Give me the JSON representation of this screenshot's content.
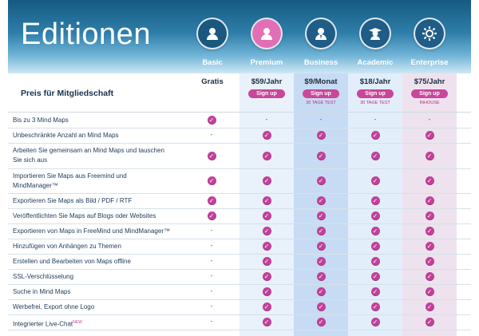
{
  "title": "Editionen",
  "columns": [
    {
      "name": "Basic",
      "price": "Gratis",
      "signup": "",
      "note": ""
    },
    {
      "name": "Premium",
      "price": "$59/Jahr",
      "signup": "Sign up",
      "note": ""
    },
    {
      "name": "Business",
      "price": "$9/Monat",
      "signup": "Sign up",
      "note": "30 TAGE TEST"
    },
    {
      "name": "Academic",
      "price": "$18/Jahr",
      "signup": "Sign up",
      "note": "30 TAGE TEST"
    },
    {
      "name": "Enterprise",
      "price": "$75/Jahr",
      "signup": "Sign up",
      "note": "INHOUSE"
    }
  ],
  "price_label": "Preis für Mitgliedschaft",
  "features": [
    {
      "label": "Bis zu 3 Mind Maps",
      "values": [
        "check",
        "dash",
        "dash",
        "dash",
        "dash"
      ]
    },
    {
      "label": "Unbeschränkte Anzahl an Mind Maps",
      "values": [
        "dash",
        "check",
        "check",
        "check",
        "check"
      ]
    },
    {
      "label": "Arbeiten Sie gemeinsam an Mind Maps und tauschen Sie sich aus",
      "values": [
        "check",
        "check",
        "check",
        "check",
        "check"
      ]
    },
    {
      "label": "Importieren Sie Maps aus Freemind und MindManager™",
      "values": [
        "check",
        "check",
        "check",
        "check",
        "check"
      ]
    },
    {
      "label": "Exportieren Sie Maps als Bild / PDF / RTF",
      "values": [
        "check",
        "check",
        "check",
        "check",
        "check"
      ]
    },
    {
      "label": "Veröffentlichten Sie Maps auf Blogs oder Websites",
      "values": [
        "check",
        "check",
        "check",
        "check",
        "check"
      ]
    },
    {
      "label": "Exportieren von Maps in FreeMind und MindManager™",
      "values": [
        "dash",
        "check",
        "check",
        "check",
        "check"
      ]
    },
    {
      "label": "Hinzufügen von Anhängen zu Themen",
      "values": [
        "dash",
        "check",
        "check",
        "check",
        "check"
      ]
    },
    {
      "label": "Erstellen und Bearbeiten von Maps offline",
      "values": [
        "dash",
        "check",
        "check",
        "check",
        "check"
      ]
    },
    {
      "label": "SSL-Verschlüsselung",
      "values": [
        "dash",
        "check",
        "check",
        "check",
        "check"
      ]
    },
    {
      "label": "Suche in Mind Maps",
      "values": [
        "dash",
        "check",
        "check",
        "check",
        "check"
      ]
    },
    {
      "label": "Werbefrei, Export ohne Logo",
      "values": [
        "dash",
        "check",
        "check",
        "check",
        "check"
      ]
    },
    {
      "label": "Integrierter Live-Chat",
      "values": [
        "dash",
        "check",
        "check",
        "check",
        "check"
      ],
      "tag": "NEW"
    }
  ],
  "colors": {
    "header_top": "#155a82",
    "accent_pink": "#c2409b",
    "premium_icon": "#e26fb6",
    "other_icon": "#1f5c86"
  },
  "icons": [
    "user-icon",
    "user-icon",
    "user-icon",
    "graduate-icon",
    "gear-icon"
  ]
}
